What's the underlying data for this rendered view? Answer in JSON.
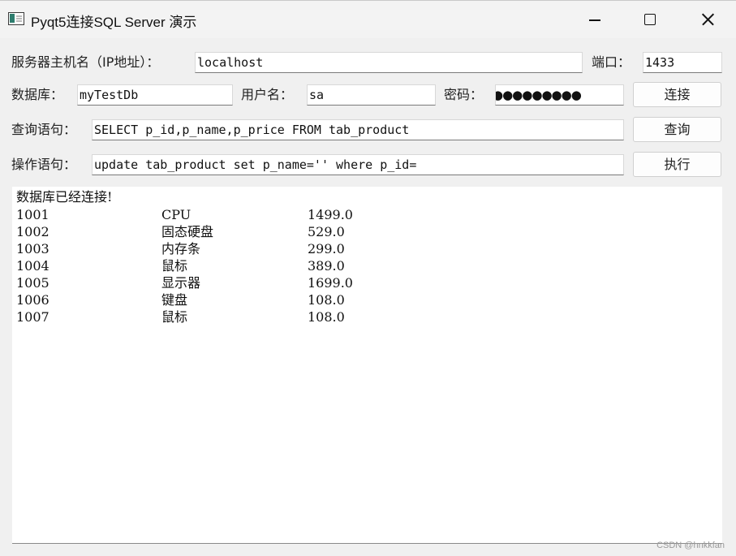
{
  "window": {
    "title": "Pyqt5连接SQL Server 演示",
    "icon": "app-window-icon"
  },
  "form": {
    "host_label": "服务器主机名（IP地址）：",
    "host_value": "localhost",
    "port_label": "端口：",
    "port_value": "1433",
    "db_label": "数据库：",
    "db_value": "myTestDb",
    "user_label": "用户名：",
    "user_value": "sa",
    "password_label": "密码：",
    "password_mask": "●●●●●●●●●",
    "connect_button": "连接",
    "query_label": "查询语句：",
    "query_value": "SELECT p_id,p_name,p_price FROM tab_product",
    "query_button": "查询",
    "exec_label": "操作语句：",
    "exec_value": "update tab_product set p_name='' where p_id=",
    "exec_button": "执行"
  },
  "output": {
    "status": "数据库已经连接!",
    "rows": [
      [
        "1001",
        "CPU",
        "1499.0"
      ],
      [
        "1002",
        "固态硬盘",
        "529.0"
      ],
      [
        "1003",
        "内存条",
        "299.0"
      ],
      [
        "1004",
        "鼠标",
        "389.0"
      ],
      [
        "1005",
        "显示器",
        "1699.0"
      ],
      [
        "1006",
        "键盘",
        "108.0"
      ],
      [
        "1007",
        "鼠标",
        "108.0"
      ]
    ]
  },
  "watermark": "CSDN @hnkkfan"
}
